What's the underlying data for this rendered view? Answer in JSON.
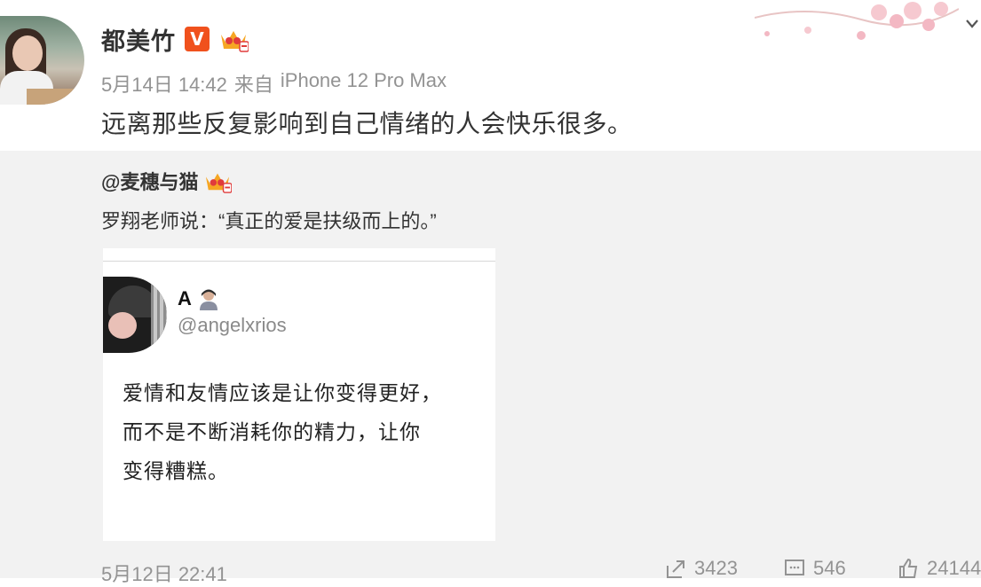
{
  "post": {
    "username": "都美竹",
    "verified_badge": "V",
    "crown_badge_icon": "crown-badge-icon",
    "date": "5月14日 14:42",
    "source_prefix": "来自",
    "source_device": "iPhone 12 Pro Max",
    "text": "远离那些反复影响到自己情绪的人会快乐很多。"
  },
  "repost": {
    "original_user": "@麦穗与猫",
    "original_text": "罗翔老师说：“真正的爱是扶级而上的。”",
    "image": {
      "tw_name": "A",
      "tw_handle": "@angelxrios",
      "lines": [
        "爱情和友情应该是让你变得更好，",
        "而不是不断消耗你的精力，让你",
        "变得糟糕。"
      ]
    },
    "footer": {
      "date": "5月12日 22:41",
      "repost_count": "3423",
      "comment_count": "546",
      "like_count": "24144"
    }
  },
  "colors": {
    "verified": "#f0511d",
    "muted": "#939393",
    "repost_bg": "#f2f2f2"
  }
}
